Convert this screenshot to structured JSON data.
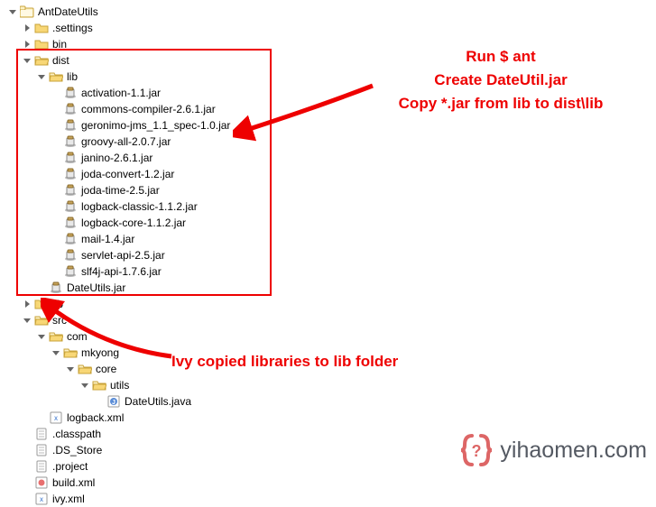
{
  "tree": {
    "root": {
      "label": "AntDateUtils",
      "icon": "project"
    },
    "settings": {
      "label": ".settings",
      "icon": "folder-closed"
    },
    "bin": {
      "label": "bin",
      "icon": "folder-closed"
    },
    "dist": {
      "label": "dist",
      "icon": "folder-open"
    },
    "dist_lib": {
      "label": "lib",
      "icon": "folder-open"
    },
    "jars": [
      "activation-1.1.jar",
      "commons-compiler-2.6.1.jar",
      "geronimo-jms_1.1_spec-1.0.jar",
      "groovy-all-2.0.7.jar",
      "janino-2.6.1.jar",
      "joda-convert-1.2.jar",
      "joda-time-2.5.jar",
      "logback-classic-1.1.2.jar",
      "logback-core-1.1.2.jar",
      "mail-1.4.jar",
      "servlet-api-2.5.jar",
      "slf4j-api-1.7.6.jar"
    ],
    "dateutils_jar": {
      "label": "DateUtils.jar",
      "icon": "jar"
    },
    "lib": {
      "label": "lib",
      "icon": "folder-closed"
    },
    "src": {
      "label": "src",
      "icon": "folder-open"
    },
    "com": {
      "label": "com",
      "icon": "folder-open"
    },
    "mkyong": {
      "label": "mkyong",
      "icon": "folder-open"
    },
    "core": {
      "label": "core",
      "icon": "folder-open"
    },
    "utils": {
      "label": "utils",
      "icon": "folder-open"
    },
    "dateutils_java": {
      "label": "DateUtils.java",
      "icon": "java"
    },
    "logback_xml": {
      "label": "logback.xml",
      "icon": "xml"
    },
    "classpath": {
      "label": ".classpath",
      "icon": "file"
    },
    "ds_store": {
      "label": ".DS_Store",
      "icon": "file"
    },
    "project": {
      "label": ".project",
      "icon": "file"
    },
    "build_xml": {
      "label": "build.xml",
      "icon": "ant"
    },
    "ivy_xml": {
      "label": "ivy.xml",
      "icon": "xml"
    }
  },
  "annotations": {
    "line1": "Run $ ant",
    "line2": "Create DateUtil.jar",
    "line3": "Copy *.jar from lib to dist\\lib",
    "line4": "Ivy copied libraries to lib folder"
  },
  "watermark": {
    "text": "yihaomen.com",
    "glyph": "?"
  }
}
